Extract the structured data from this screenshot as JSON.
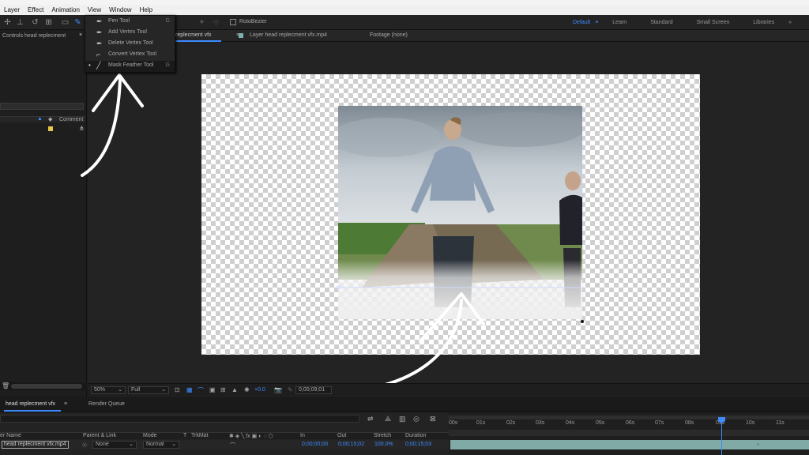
{
  "menubar": {
    "items": [
      "Layer",
      "Effect",
      "Animation",
      "View",
      "Window",
      "Help"
    ]
  },
  "workspaces": {
    "items": [
      "Default",
      "Learn",
      "Standard",
      "Small Screen",
      "Libraries"
    ],
    "active": "Default",
    "more": "»"
  },
  "toolbar": {
    "rotobezier_label": "RotoBezier"
  },
  "left_panel": {
    "tab_label": "Controls head replecment",
    "close_glyph": "×",
    "comment_header": "Comment"
  },
  "viewer": {
    "comp_tab": "replecment vfx",
    "layer_tab": "Layer  head replecment vfx.mp4",
    "footage_tab": "Footage  (none)"
  },
  "pen_menu": {
    "items": [
      {
        "label": "Pen Tool",
        "shortcut": "G",
        "icon": "pen-icon",
        "selected": false
      },
      {
        "label": "Add Vertex Tool",
        "shortcut": "",
        "icon": "add-vertex-icon",
        "selected": false
      },
      {
        "label": "Delete Vertex Tool",
        "shortcut": "",
        "icon": "delete-vertex-icon",
        "selected": false
      },
      {
        "label": "Convert Vertex Tool",
        "shortcut": "",
        "icon": "convert-vertex-icon",
        "selected": false
      },
      {
        "label": "Mask Feather Tool",
        "shortcut": "G",
        "icon": "mask-feather-icon",
        "selected": true
      }
    ]
  },
  "viewer_footer": {
    "zoom": "50%",
    "resolution": "Full",
    "exposure": "+0.0",
    "timecode": "0;00;09;01"
  },
  "timeline_tabs": {
    "comp_tab": "head replecment vfx",
    "render_queue": "Render Queue"
  },
  "timeline": {
    "columns": [
      "er Name",
      "Parent & Link",
      "Mode",
      "T",
      "TrkMat",
      "In",
      "Out",
      "Stretch",
      "Duration"
    ],
    "ruler_ticks": [
      "00s",
      "01s",
      "02s",
      "03s",
      "04s",
      "05s",
      "06s",
      "07s",
      "08s",
      "09s",
      "10s",
      "11s"
    ],
    "layer": {
      "name": "head replecment vfx.mp4",
      "parent": "None",
      "mode": "Normal",
      "in": "0;00;00;00",
      "out": "0;00;15;02",
      "stretch": "100.0%",
      "duration": "0;00;15;03"
    }
  },
  "colors": {
    "accent": "#3d8bff",
    "label_yellow": "#e5c84a",
    "layer_bar": "#7faaa6",
    "playhead": "#3d8bff"
  }
}
